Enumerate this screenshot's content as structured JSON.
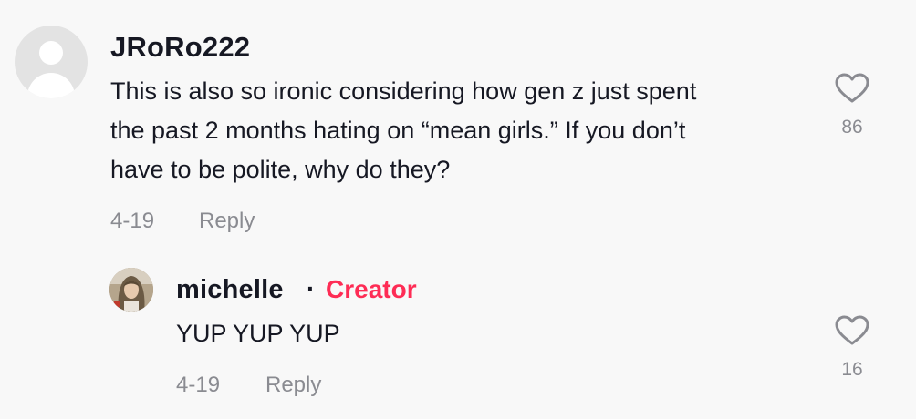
{
  "comment": {
    "username": "JRoRo222",
    "text_lines": [
      "This is also so ironic considering how gen z just spent",
      "the past 2 months hating on “mean girls.” If you don’t",
      "have to be polite, why do they?"
    ],
    "date": "4-19",
    "reply_label": "Reply",
    "likes": "86",
    "avatar_icon": "default-user-avatar-icon",
    "like_icon": "heart-outline-icon"
  },
  "reply": {
    "username": "michelle",
    "separator": "·",
    "badge": "Creator",
    "text": "YUP YUP YUP",
    "date": "4-19",
    "reply_label": "Reply",
    "likes": "16",
    "like_icon": "heart-outline-icon"
  },
  "colors": {
    "background": "#f8f8f8",
    "primary_text": "#161823",
    "secondary_text": "#8a8b91",
    "creator_badge": "#fe2c55"
  }
}
